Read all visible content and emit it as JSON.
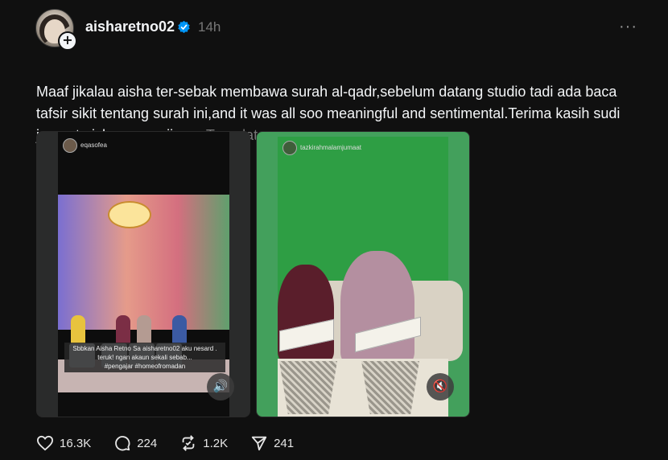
{
  "post": {
    "username": "aisharetno02",
    "time": "14h",
    "more": "···",
    "caption": "Maaf jikalau aisha ter-sebak membawa surah al-qadr,sebelum datang studio tadi ada baca tafsir sikit tentang surah ini,and it was all soo meaningful and sentimental.Terima kasih sudi jemput aisha mengaji .",
    "caption_emoji": "♥",
    "translate": "Translate"
  },
  "media": [
    {
      "account": "eqasofea",
      "subtitle_line1": "Sbbkan Aisha Retno Sa aisharetno02 aku nesard .",
      "subtitle_line2": "teruk! ngan akaun sekali sebab...",
      "subtitle_line3": "#pengajar #homeofromadan",
      "sound_icon": "volume-icon"
    },
    {
      "account": "tazkirahmalamjumaat",
      "sound_icon": "muted-icon"
    }
  ],
  "actions": {
    "likes": "16.3K",
    "comments": "224",
    "reposts": "1.2K",
    "shares": "241"
  },
  "colors": {
    "background": "#101010",
    "verified": "#0095f6",
    "heart": "#e8425f"
  }
}
